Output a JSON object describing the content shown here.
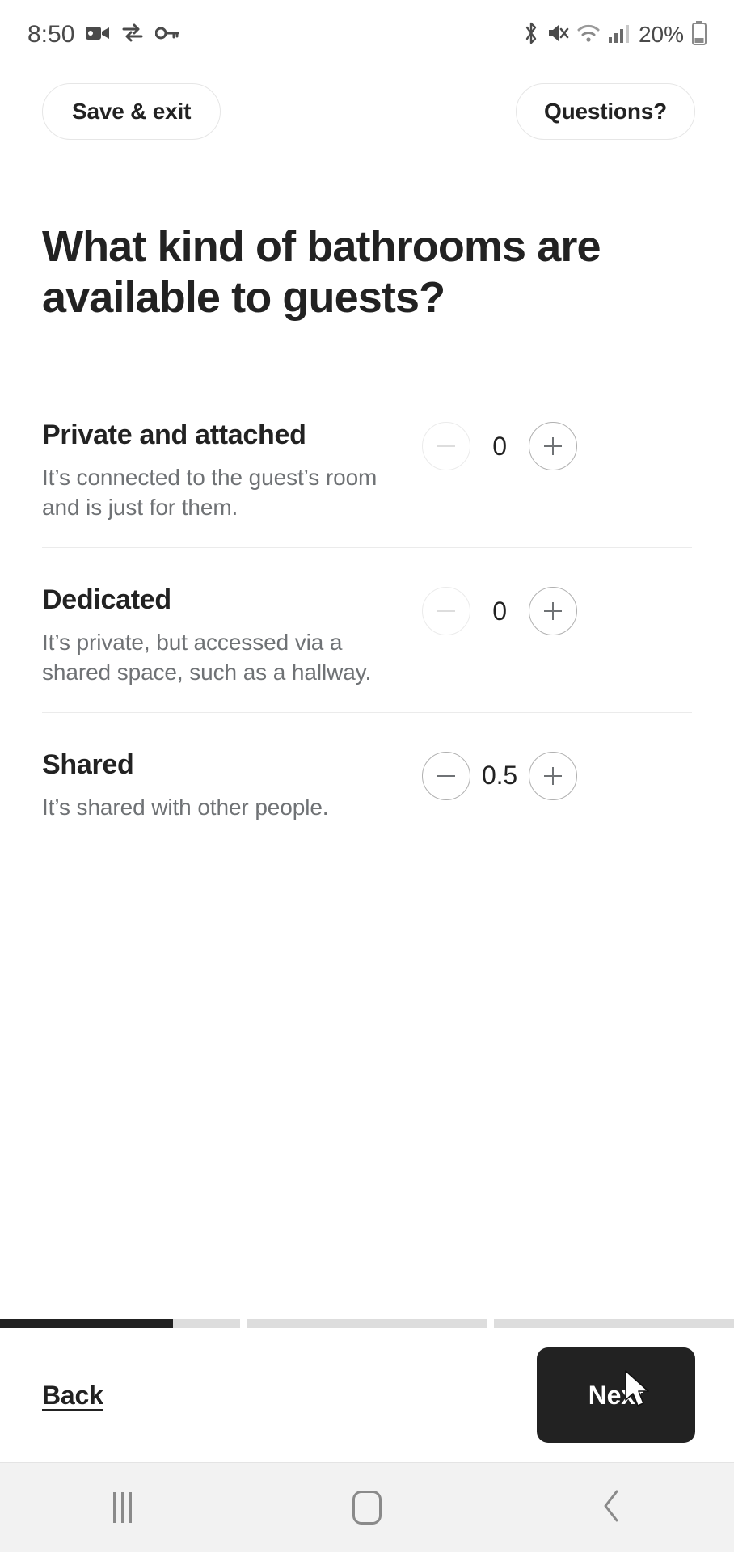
{
  "status_bar": {
    "time": "8:50",
    "battery_percent": "20%",
    "left_icons": [
      "video-camera-icon",
      "data-transfer-icon",
      "key-icon"
    ],
    "right_icons": [
      "bluetooth-icon",
      "mute-icon",
      "wifi-icon",
      "cellular-signal-icon",
      "battery-icon"
    ]
  },
  "top_bar": {
    "save_exit_label": "Save & exit",
    "questions_label": "Questions?"
  },
  "main": {
    "title": "What kind of bathrooms are available to guests?",
    "options": [
      {
        "name": "Private and attached",
        "description": "It’s connected to the guest’s room and is just for them.",
        "value": "0",
        "decrement_enabled": false,
        "increment_enabled": true
      },
      {
        "name": "Dedicated",
        "description": "It’s private, but accessed via a shared space, such as a hallway.",
        "value": "0",
        "decrement_enabled": false,
        "increment_enabled": true
      },
      {
        "name": "Shared",
        "description": "It’s shared with other people.",
        "value": "0.5",
        "decrement_enabled": true,
        "increment_enabled": true
      }
    ]
  },
  "progress": {
    "segments": [
      72,
      0,
      0
    ],
    "fill_color": "#222222",
    "track_color": "#dddddd"
  },
  "footer": {
    "back_label": "Back",
    "next_label": "Next",
    "next_bg": "#222222"
  },
  "system_nav": {
    "recents_label": "recents-button",
    "home_label": "home-button",
    "back_label": "back-button"
  }
}
